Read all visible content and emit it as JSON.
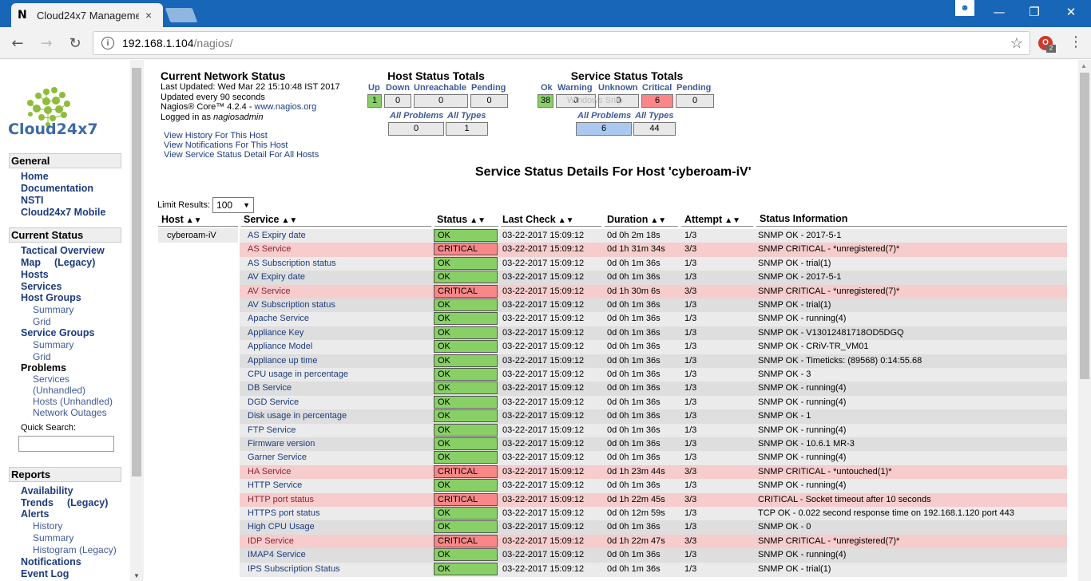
{
  "browser": {
    "tab_icon": "N",
    "tab_title": "Cloud24x7 Manageme",
    "tab_close": "×",
    "url_host": "192.168.1.104",
    "url_path": "/nagios/",
    "extension_badge": "2"
  },
  "sidebar": {
    "logo_text": "Cloud24x7",
    "general_title": "General",
    "general_items": [
      "Home",
      "Documentation",
      "NSTI",
      "Cloud24x7 Mobile"
    ],
    "current_status_title": "Current Status",
    "tactical": "Tactical Overview",
    "map": "Map",
    "map_legacy": "(Legacy)",
    "hosts": "Hosts",
    "services": "Services",
    "host_groups": "Host Groups",
    "hg_summary": "Summary",
    "hg_grid": "Grid",
    "service_groups": "Service Groups",
    "sg_summary": "Summary",
    "sg_grid": "Grid",
    "problems": "Problems",
    "p_services": "Services",
    "p_unhandled": "(Unhandled)",
    "p_hosts": "Hosts (Unhandled)",
    "p_outages": "Network Outages",
    "quick_search": "Quick Search:",
    "reports_title": "Reports",
    "availability": "Availability",
    "trends": "Trends",
    "trends_legacy": "(Legacy)",
    "alerts": "Alerts",
    "a_history": "History",
    "a_summary": "Summary",
    "a_histogram": "Histogram (Legacy)",
    "notifications": "Notifications",
    "event_log": "Event Log"
  },
  "status_info": {
    "title": "Current Network Status",
    "last_updated": "Last Updated: Wed Mar 22 15:10:48 IST 2017",
    "update_interval": "Updated every 90 seconds",
    "core_prefix": "Nagios® Core™ 4.2.4 - ",
    "core_link": "www.nagios.org",
    "logged_prefix": "Logged in as ",
    "logged_user": "nagiosadmin",
    "link_history": "View History For This Host",
    "link_notifications": "View Notifications For This Host",
    "link_service_detail": "View Service Status Detail For All Hosts"
  },
  "host_totals": {
    "title": "Host Status Totals",
    "labels": [
      "Up",
      "Down",
      "Unreachable",
      "Pending"
    ],
    "values": [
      "1",
      "0",
      "0",
      "0"
    ],
    "all_problems_label": "All Problems",
    "all_types_label": "All Types",
    "all_problems": "0",
    "all_types": "1"
  },
  "service_totals": {
    "title": "Service Status Totals",
    "labels": [
      "Ok",
      "Warning",
      "Unknown",
      "Critical",
      "Pending"
    ],
    "values": [
      "38",
      "0",
      "0",
      "6",
      "0"
    ],
    "all_problems_label": "All Problems",
    "all_types_label": "All Types",
    "all_problems": "6",
    "all_types": "44",
    "watermark": "Windows Snip"
  },
  "page_title": "Service Status Details For Host 'cyberoam-iV'",
  "limit": {
    "label": "Limit Results:",
    "value": "100"
  },
  "columns": [
    "Host",
    "Service",
    "Status",
    "Last Check",
    "Duration",
    "Attempt",
    "Status Information"
  ],
  "host_name": "cyberoam-iV",
  "rows": [
    {
      "service": "AS Expiry date",
      "status": "OK",
      "last_check": "03-22-2017 15:09:12",
      "duration": "0d 0h 2m 18s",
      "attempt": "1/3",
      "info": "SNMP OK - 2017-5-1"
    },
    {
      "service": "AS Service",
      "status": "CRITICAL",
      "last_check": "03-22-2017 15:09:12",
      "duration": "0d 1h 31m 34s",
      "attempt": "3/3",
      "info": "SNMP CRITICAL - *unregistered(7)*"
    },
    {
      "service": "AS Subscription status",
      "status": "OK",
      "last_check": "03-22-2017 15:09:12",
      "duration": "0d 0h 1m 36s",
      "attempt": "1/3",
      "info": "SNMP OK - trial(1)"
    },
    {
      "service": "AV Expiry date",
      "status": "OK",
      "last_check": "03-22-2017 15:09:12",
      "duration": "0d 0h 1m 36s",
      "attempt": "1/3",
      "info": "SNMP OK - 2017-5-1"
    },
    {
      "service": "AV Service",
      "status": "CRITICAL",
      "last_check": "03-22-2017 15:09:12",
      "duration": "0d 1h 30m 6s",
      "attempt": "3/3",
      "info": "SNMP CRITICAL - *unregistered(7)*"
    },
    {
      "service": "AV Subscription status",
      "status": "OK",
      "last_check": "03-22-2017 15:09:12",
      "duration": "0d 0h 1m 36s",
      "attempt": "1/3",
      "info": "SNMP OK - trial(1)"
    },
    {
      "service": "Apache Service",
      "status": "OK",
      "last_check": "03-22-2017 15:09:12",
      "duration": "0d 0h 1m 36s",
      "attempt": "1/3",
      "info": "SNMP OK - running(4)"
    },
    {
      "service": "Appliance Key",
      "status": "OK",
      "last_check": "03-22-2017 15:09:12",
      "duration": "0d 0h 1m 36s",
      "attempt": "1/3",
      "info": "SNMP OK - V13012481718OD5DGQ"
    },
    {
      "service": "Appliance Model",
      "status": "OK",
      "last_check": "03-22-2017 15:09:12",
      "duration": "0d 0h 1m 36s",
      "attempt": "1/3",
      "info": "SNMP OK - CRiV-TR_VM01"
    },
    {
      "service": "Appliance up time",
      "status": "OK",
      "last_check": "03-22-2017 15:09:12",
      "duration": "0d 0h 1m 36s",
      "attempt": "1/3",
      "info": "SNMP OK - Timeticks: (89568) 0:14:55.68"
    },
    {
      "service": "CPU usage in percentage",
      "status": "OK",
      "last_check": "03-22-2017 15:09:12",
      "duration": "0d 0h 1m 36s",
      "attempt": "1/3",
      "info": "SNMP OK - 3"
    },
    {
      "service": "DB Service",
      "status": "OK",
      "last_check": "03-22-2017 15:09:12",
      "duration": "0d 0h 1m 36s",
      "attempt": "1/3",
      "info": "SNMP OK - running(4)"
    },
    {
      "service": "DGD Service",
      "status": "OK",
      "last_check": "03-22-2017 15:09:12",
      "duration": "0d 0h 1m 36s",
      "attempt": "1/3",
      "info": "SNMP OK - running(4)"
    },
    {
      "service": "Disk usage in percentage",
      "status": "OK",
      "last_check": "03-22-2017 15:09:12",
      "duration": "0d 0h 1m 36s",
      "attempt": "1/3",
      "info": "SNMP OK - 1"
    },
    {
      "service": "FTP Service",
      "status": "OK",
      "last_check": "03-22-2017 15:09:12",
      "duration": "0d 0h 1m 36s",
      "attempt": "1/3",
      "info": "SNMP OK - running(4)"
    },
    {
      "service": "Firmware version",
      "status": "OK",
      "last_check": "03-22-2017 15:09:12",
      "duration": "0d 0h 1m 36s",
      "attempt": "1/3",
      "info": "SNMP OK - 10.6.1 MR-3"
    },
    {
      "service": "Garner Service",
      "status": "OK",
      "last_check": "03-22-2017 15:09:12",
      "duration": "0d 0h 1m 36s",
      "attempt": "1/3",
      "info": "SNMP OK - running(4)"
    },
    {
      "service": "HA Service",
      "status": "CRITICAL",
      "last_check": "03-22-2017 15:09:12",
      "duration": "0d 1h 23m 44s",
      "attempt": "3/3",
      "info": "SNMP CRITICAL - *untouched(1)*"
    },
    {
      "service": "HTTP Service",
      "status": "OK",
      "last_check": "03-22-2017 15:09:12",
      "duration": "0d 0h 1m 36s",
      "attempt": "1/3",
      "info": "SNMP OK - running(4)"
    },
    {
      "service": "HTTP port status",
      "status": "CRITICAL",
      "last_check": "03-22-2017 15:09:12",
      "duration": "0d 1h 22m 45s",
      "attempt": "3/3",
      "info": "CRITICAL - Socket timeout after 10 seconds"
    },
    {
      "service": "HTTPS port status",
      "status": "OK",
      "last_check": "03-22-2017 15:09:12",
      "duration": "0d 0h 12m 59s",
      "attempt": "1/3",
      "info": "TCP OK - 0.022 second response time on 192.168.1.120 port 443"
    },
    {
      "service": "High CPU Usage",
      "status": "OK",
      "last_check": "03-22-2017 15:09:12",
      "duration": "0d 0h 1m 36s",
      "attempt": "1/3",
      "info": "SNMP OK - 0"
    },
    {
      "service": "IDP Service",
      "status": "CRITICAL",
      "last_check": "03-22-2017 15:09:12",
      "duration": "0d 1h 22m 47s",
      "attempt": "3/3",
      "info": "SNMP CRITICAL - *unregistered(7)*"
    },
    {
      "service": "IMAP4 Service",
      "status": "OK",
      "last_check": "03-22-2017 15:09:12",
      "duration": "0d 0h 1m 36s",
      "attempt": "1/3",
      "info": "SNMP OK - running(4)"
    },
    {
      "service": "IPS Subscription Status",
      "status": "OK",
      "last_check": "03-22-2017 15:09:12",
      "duration": "0d 0h 1m 36s",
      "attempt": "1/3",
      "info": "SNMP OK - trial(1)"
    }
  ],
  "colors": {
    "ok": "#88d066",
    "critical": "#f88888",
    "pending_row": "#f6cccc",
    "chrome_blue": "#1866b7"
  }
}
